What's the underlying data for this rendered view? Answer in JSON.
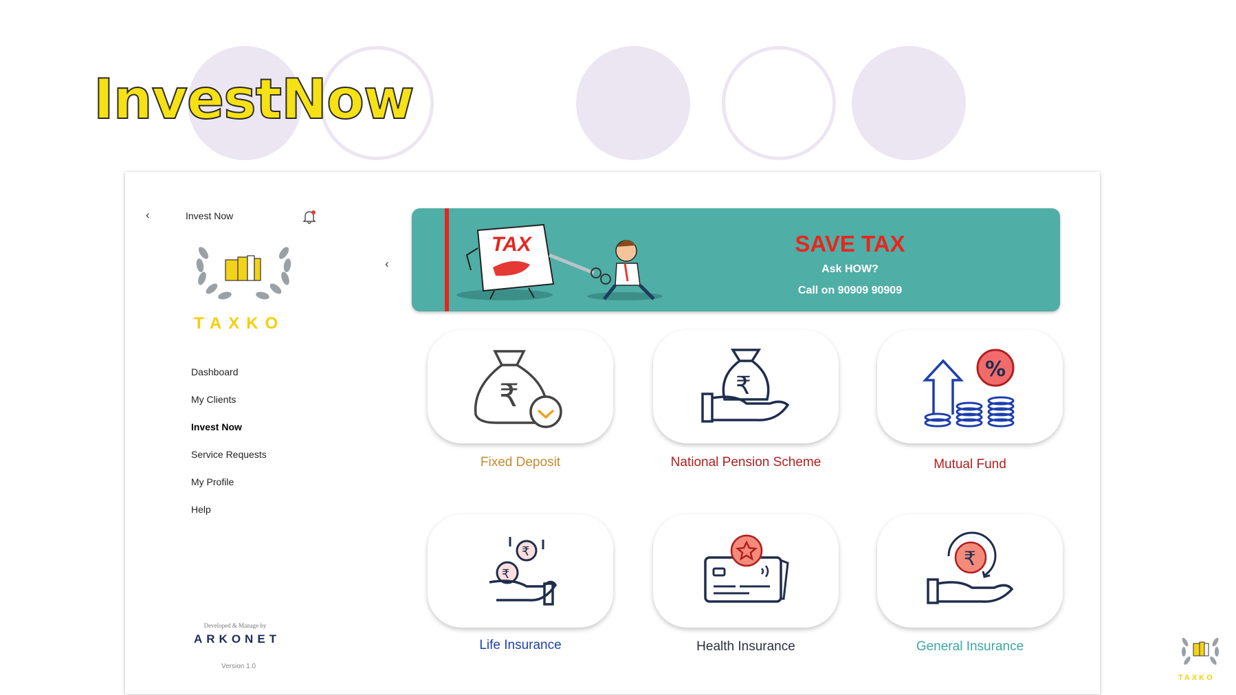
{
  "slide": {
    "title": "InvestNow"
  },
  "sidebar": {
    "header_title": "Invest Now",
    "brand": "TAXKO",
    "nav": [
      {
        "label": "Dashboard",
        "active": false
      },
      {
        "label": "My Clients",
        "active": false
      },
      {
        "label": "Invest Now",
        "active": true
      },
      {
        "label": "Service Requests",
        "active": false
      },
      {
        "label": "My Profile",
        "active": false
      },
      {
        "label": "Help",
        "active": false
      }
    ],
    "developer_note": "Developed & Manage by",
    "developer_logo": "ARKONET",
    "version": "Version 1.0"
  },
  "banner": {
    "art_text": "TAX",
    "headline": "SAVE TAX",
    "subline": "Ask HOW?",
    "call": "Call on 90909 90909"
  },
  "tiles": [
    {
      "label": "Fixed Deposit",
      "icon": "money-bag-checkmark-icon",
      "color": "#c48a2f"
    },
    {
      "label": "National Pension Scheme",
      "icon": "hand-money-bag-icon",
      "color": "#b01f1f"
    },
    {
      "label": "Mutual Fund",
      "icon": "coins-growth-percent-icon",
      "color": "#b01f1f"
    },
    {
      "label": "Life Insurance",
      "icon": "hand-coins-icon",
      "color": "#1d3fae"
    },
    {
      "label": "Health Insurance",
      "icon": "insurance-card-icon",
      "color": "#2b2f3f"
    },
    {
      "label": "General Insurance",
      "icon": "hand-rupee-coin-icon",
      "color": "#3aa8a0"
    }
  ],
  "corner_brand": "TAXKO",
  "colors": {
    "accent_yellow": "#f6e114",
    "banner_teal": "#4faea6",
    "banner_red": "#e52620",
    "circle_lavender": "#ece5f2"
  }
}
